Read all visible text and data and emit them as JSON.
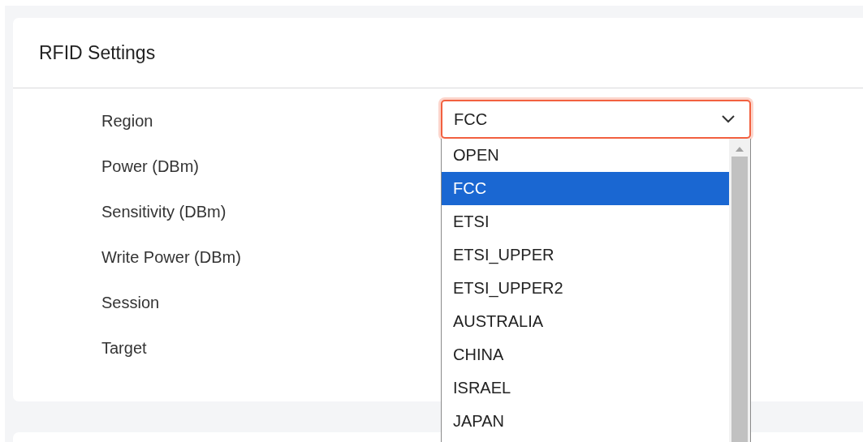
{
  "card": {
    "title": "RFID Settings"
  },
  "fields": [
    {
      "label": "Region",
      "kind": "select",
      "value": "FCC",
      "expanded": true,
      "options": [
        {
          "label": "OPEN",
          "selected": false
        },
        {
          "label": "FCC",
          "selected": true
        },
        {
          "label": "ETSI",
          "selected": false
        },
        {
          "label": "ETSI_UPPER",
          "selected": false
        },
        {
          "label": "ETSI_UPPER2",
          "selected": false
        },
        {
          "label": "AUSTRALIA",
          "selected": false
        },
        {
          "label": "CHINA",
          "selected": false
        },
        {
          "label": "ISRAEL",
          "selected": false
        },
        {
          "label": "JAPAN",
          "selected": false
        }
      ]
    },
    {
      "label": "Power (DBm)",
      "kind": "label"
    },
    {
      "label": "Sensitivity (DBm)",
      "kind": "label"
    },
    {
      "label": "Write Power (DBm)",
      "kind": "label"
    },
    {
      "label": "Session",
      "kind": "label"
    },
    {
      "label": "Target",
      "kind": "label"
    }
  ]
}
